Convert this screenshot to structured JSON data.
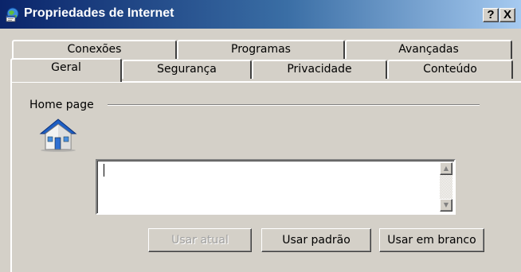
{
  "window": {
    "title": "Propriedades de Internet",
    "help_button": "?",
    "close_button": "X"
  },
  "tabs": {
    "back_row": [
      {
        "label": "Conexões"
      },
      {
        "label": "Programas"
      },
      {
        "label": "Avançadas"
      }
    ],
    "front_row": [
      {
        "label": "Geral",
        "active": true
      },
      {
        "label": "Segurança"
      },
      {
        "label": "Privacidade"
      },
      {
        "label": "Conteúdo"
      }
    ]
  },
  "home_page": {
    "section_label": "Home page",
    "address_value": "",
    "buttons": {
      "use_current": "Usar atual",
      "use_default": "Usar padrão",
      "use_blank": "Usar em branco"
    }
  },
  "colors": {
    "titlebar_start": "#0a246a",
    "titlebar_end": "#a6caf0",
    "face": "#d4d0c8"
  },
  "icons": [
    "ie-globe-icon",
    "house-icon",
    "scroll-up-icon",
    "scroll-down-icon"
  ]
}
